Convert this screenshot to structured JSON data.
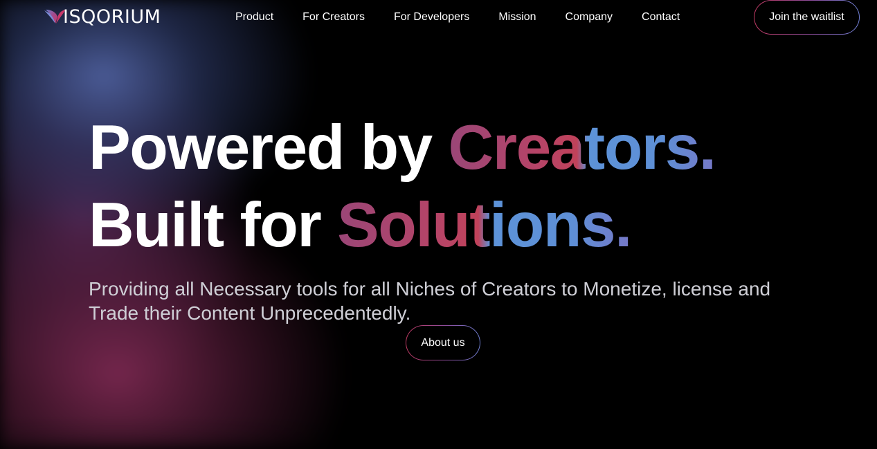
{
  "brand": {
    "name": "ISQORIUM",
    "logo_icon": "wing-logo-icon"
  },
  "nav": {
    "items": [
      {
        "label": "Product"
      },
      {
        "label": "For Creators"
      },
      {
        "label": "For Developers"
      },
      {
        "label": "Mission"
      },
      {
        "label": "Company"
      },
      {
        "label": "Contact"
      }
    ],
    "cta_label": "Join the waitlist"
  },
  "hero": {
    "line1_plain": "Powered by ",
    "line1_highlight": "Creators.",
    "line2_plain": "Built for ",
    "line2_highlight": "Solutions.",
    "subtitle": "Providing all Necessary tools for all Niches of Creators to Monetize, license and Trade their Content Unprecedentedly.",
    "about_label": "About us"
  },
  "colors": {
    "background": "#000000",
    "text": "#ffffff",
    "subtitle": "#cfcfd6",
    "accent_pink": "#c0425a",
    "accent_blue": "#5e8fd6",
    "accent_purple": "#8d4e9e"
  }
}
